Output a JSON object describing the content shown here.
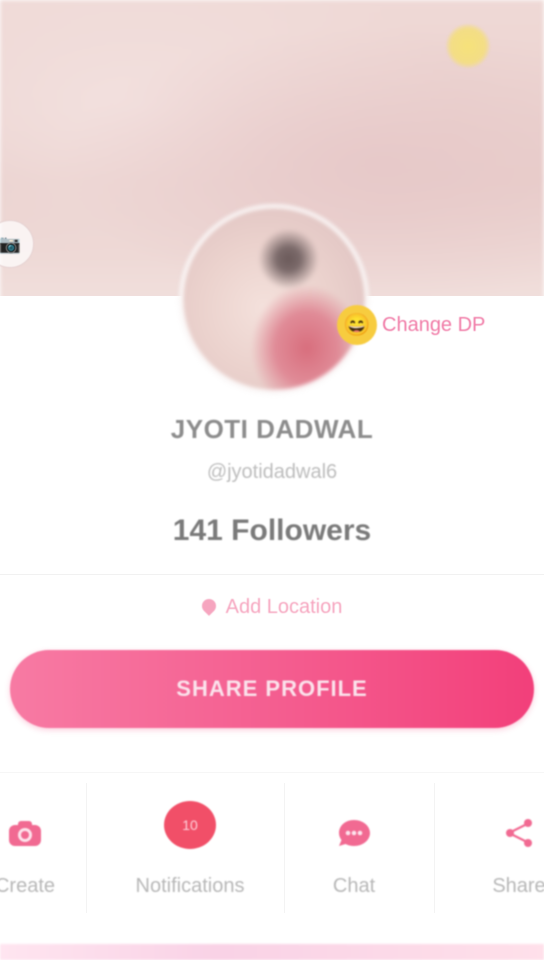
{
  "profile": {
    "name": "JYOTI DADWAL",
    "handle": "@jyotidadwal6",
    "followers_text": "141 Followers",
    "change_dp_label": "Change DP",
    "add_location_label": "Add Location",
    "share_profile_label": "SHARE PROFILE"
  },
  "tabs": [
    {
      "label": "Create",
      "icon": "camera-icon"
    },
    {
      "label": "Notifications",
      "icon": "notification-bubble-icon",
      "badge": "10"
    },
    {
      "label": "Chat",
      "icon": "chat-icon"
    },
    {
      "label": "Share",
      "icon": "share-icon"
    }
  ],
  "colors": {
    "accent_pink": "#f23f7a",
    "accent_pink_light": "#f77aa3",
    "change_dp": "#f07aa6",
    "location": "#f6a5bf",
    "badge": "#f14f68"
  }
}
